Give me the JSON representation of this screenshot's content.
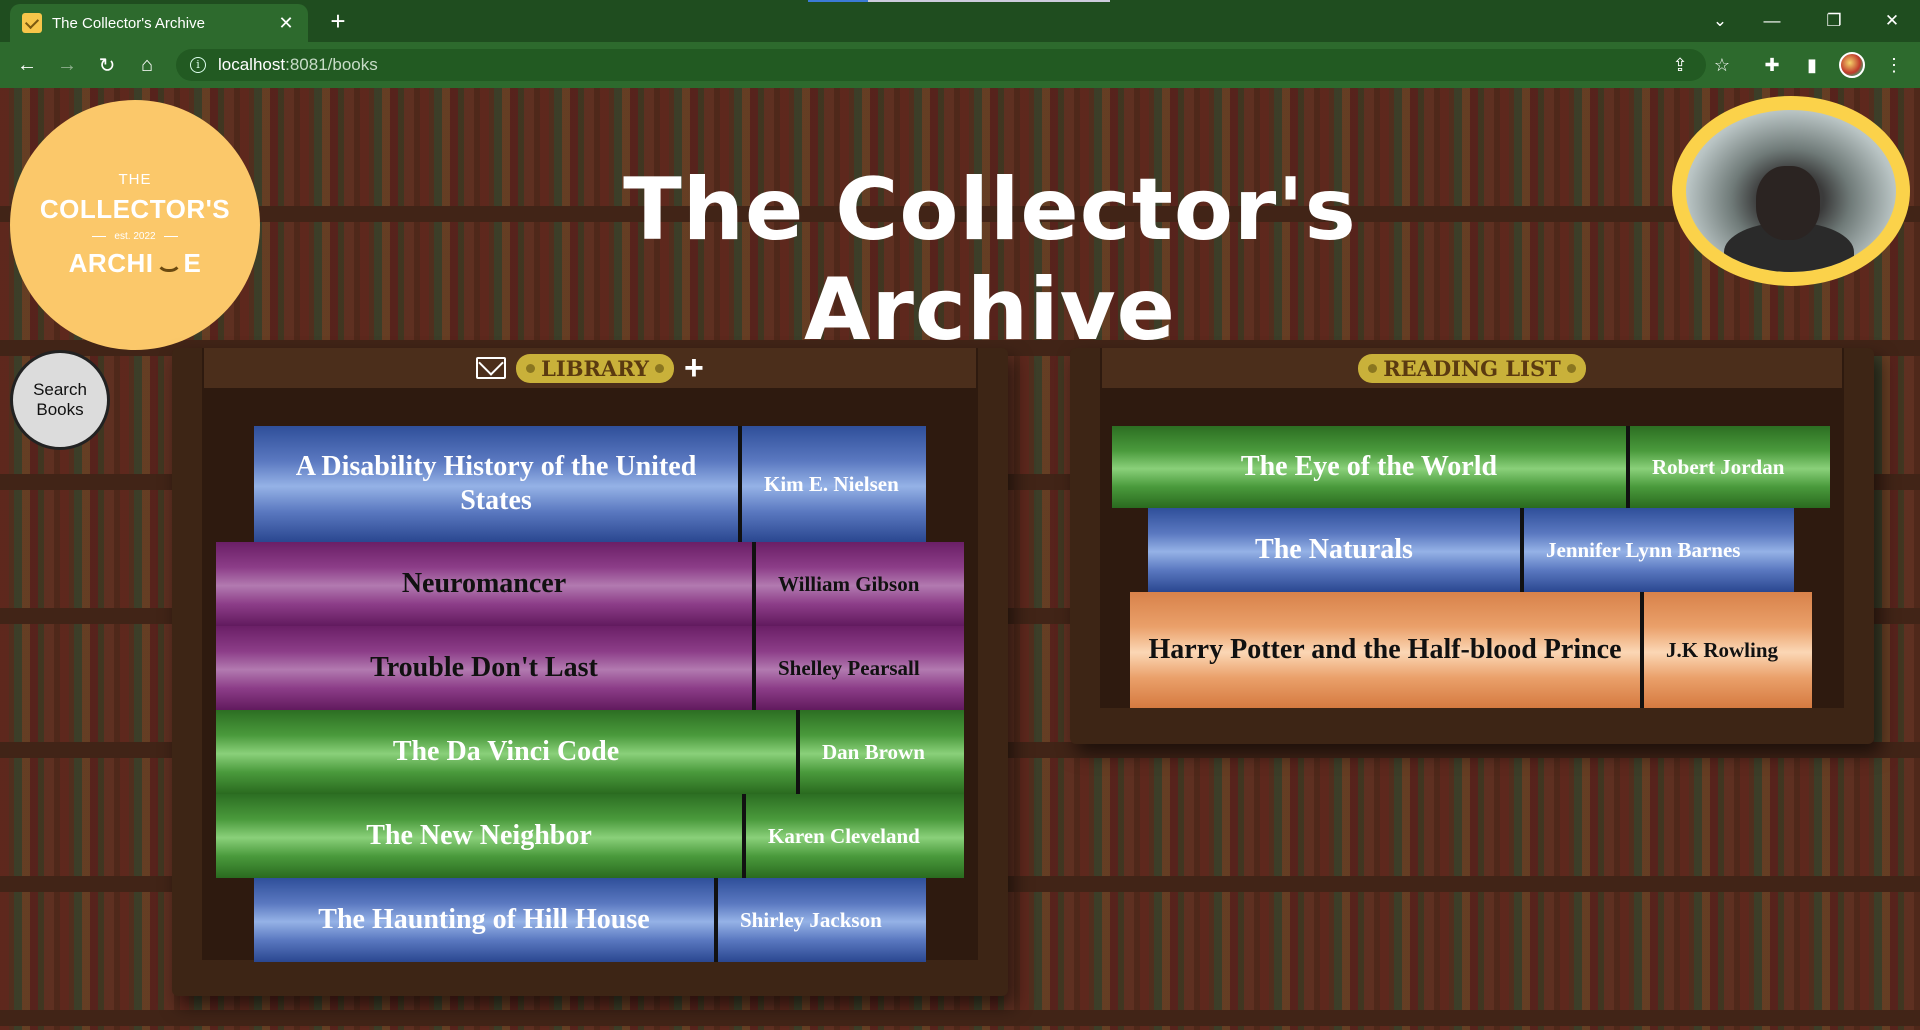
{
  "browser": {
    "tab_title": "The Collector's Archive",
    "tab_close": "✕",
    "new_tab": "+",
    "url_host": "localhost",
    "url_rest": ":8081/books",
    "win_min": "—",
    "win_restore": "❐",
    "win_close": "✕",
    "win_dropdown": "⌄"
  },
  "logo": {
    "the": "THE",
    "main": "COLLECTOR'S",
    "est": "est. 2022",
    "arch_left": "ARCHI",
    "arch_right": "E"
  },
  "search_button": "Search Books",
  "page_title": "The Collector's Archive",
  "library": {
    "label": "LIBRARY",
    "books": [
      {
        "title": "A Disability History of the United States",
        "author": "Kim E. Nielsen",
        "color": "blue"
      },
      {
        "title": "Neuromancer",
        "author": "William Gibson",
        "color": "purple"
      },
      {
        "title": "Trouble Don't Last",
        "author": "Shelley Pearsall",
        "color": "purple"
      },
      {
        "title": "The Da Vinci Code",
        "author": "Dan Brown",
        "color": "green"
      },
      {
        "title": "The New Neighbor",
        "author": "Karen Cleveland",
        "color": "green"
      },
      {
        "title": "The Haunting of Hill House",
        "author": "Shirley Jackson",
        "color": "blue"
      }
    ]
  },
  "reading_list": {
    "label": "READING LIST",
    "books": [
      {
        "title": "The Eye of the World",
        "author": "Robert Jordan",
        "color": "green"
      },
      {
        "title": "The Naturals",
        "author": "Jennifer Lynn Barnes",
        "color": "blue"
      },
      {
        "title": "Harry Potter and the Half-blood Prince",
        "author": "J.K Rowling",
        "color": "orange"
      }
    ]
  },
  "colors": {
    "accent_yellow": "#fbc86a",
    "chrome_green": "#2d6a2d"
  }
}
